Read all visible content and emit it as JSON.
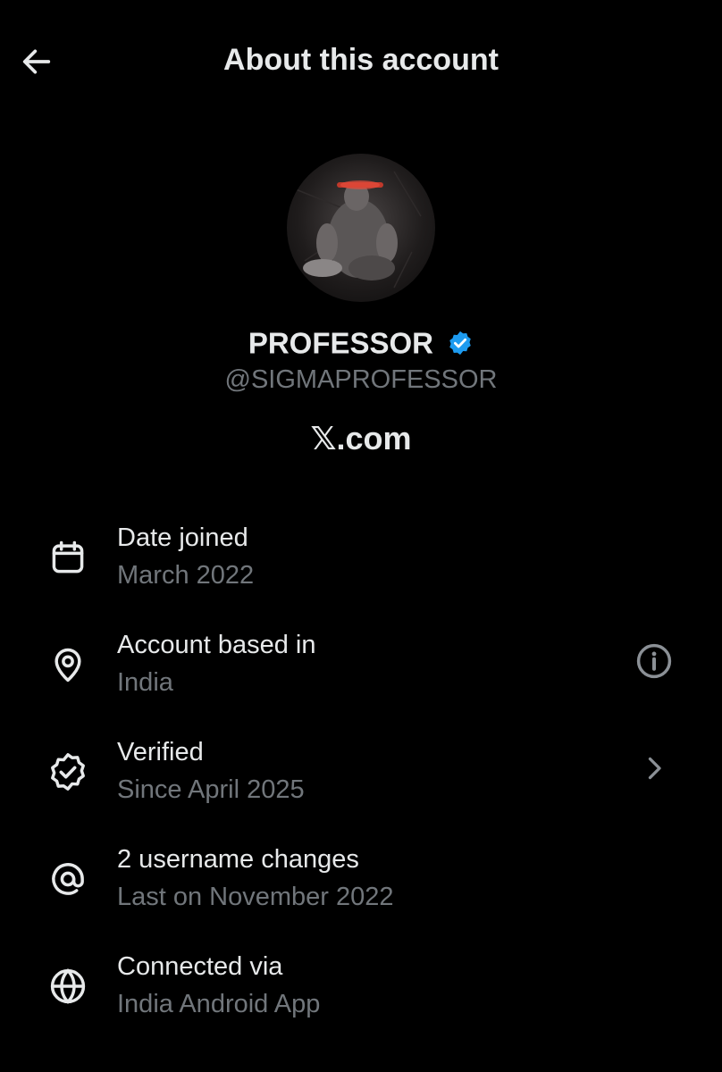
{
  "header": {
    "title": "About this account",
    "back_icon": "arrow-left-icon"
  },
  "profile": {
    "display_name": "PROFESSOR",
    "handle": "@SIGMAPROFESSOR",
    "site": "𝕏.com",
    "verified_color": "#1d9bf0"
  },
  "rows": [
    {
      "icon": "calendar-icon",
      "title": "Date joined",
      "subtitle": "March 2022"
    },
    {
      "icon": "location-pin-icon",
      "title": "Account based in",
      "subtitle": "India",
      "action_icon": "info-icon"
    },
    {
      "icon": "verified-badge-icon",
      "title": "Verified",
      "subtitle": "Since April 2025",
      "action_icon": "chevron-right-icon"
    },
    {
      "icon": "at-sign-icon",
      "title": "2 username changes",
      "subtitle": "Last on November 2022"
    },
    {
      "icon": "globe-icon",
      "title": "Connected via",
      "subtitle": "India Android App"
    }
  ],
  "colors": {
    "background": "#000000",
    "primary_text": "#e7e9ea",
    "secondary_text": "#71767b"
  }
}
